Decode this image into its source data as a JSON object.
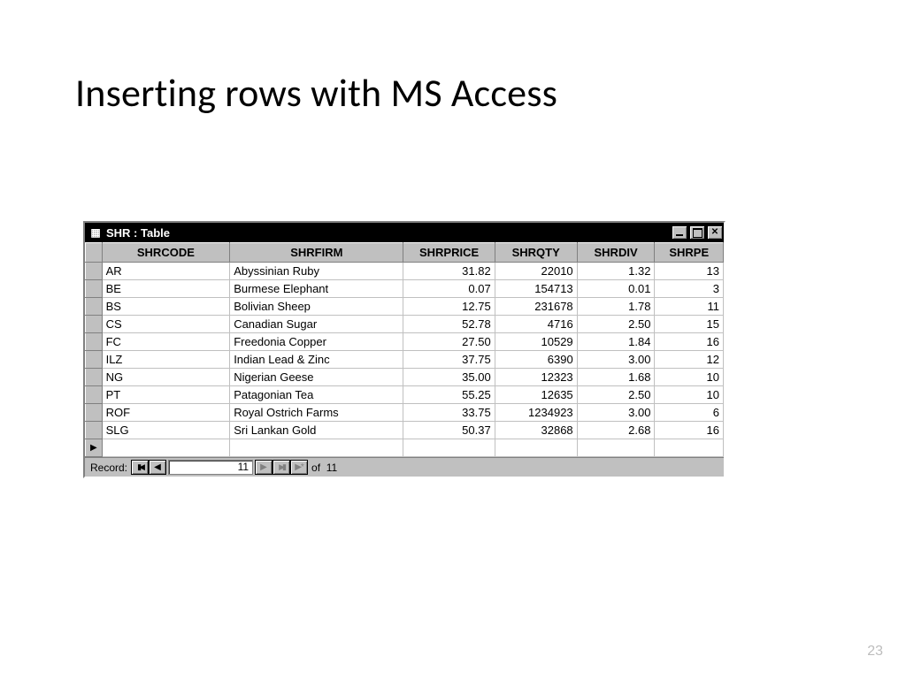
{
  "slide": {
    "title": "Inserting rows with MS Access",
    "page_number": "23"
  },
  "window": {
    "title": "SHR : Table"
  },
  "table": {
    "columns": [
      "SHRCODE",
      "SHRFIRM",
      "SHRPRICE",
      "SHRQTY",
      "SHRDIV",
      "SHRPE"
    ],
    "rows": [
      {
        "code": "AR",
        "firm": "Abyssinian Ruby",
        "price": "31.82",
        "qty": "22010",
        "div": "1.32",
        "pe": "13"
      },
      {
        "code": "BE",
        "firm": "Burmese Elephant",
        "price": "0.07",
        "qty": "154713",
        "div": "0.01",
        "pe": "3"
      },
      {
        "code": "BS",
        "firm": "Bolivian Sheep",
        "price": "12.75",
        "qty": "231678",
        "div": "1.78",
        "pe": "11"
      },
      {
        "code": "CS",
        "firm": "Canadian Sugar",
        "price": "52.78",
        "qty": "4716",
        "div": "2.50",
        "pe": "15"
      },
      {
        "code": "FC",
        "firm": "Freedonia Copper",
        "price": "27.50",
        "qty": "10529",
        "div": "1.84",
        "pe": "16"
      },
      {
        "code": "ILZ",
        "firm": "Indian Lead & Zinc",
        "price": "37.75",
        "qty": "6390",
        "div": "3.00",
        "pe": "12"
      },
      {
        "code": "NG",
        "firm": "Nigerian Geese",
        "price": "35.00",
        "qty": "12323",
        "div": "1.68",
        "pe": "10"
      },
      {
        "code": "PT",
        "firm": "Patagonian Tea",
        "price": "55.25",
        "qty": "12635",
        "div": "2.50",
        "pe": "10"
      },
      {
        "code": "ROF",
        "firm": "Royal Ostrich Farms",
        "price": "33.75",
        "qty": "1234923",
        "div": "3.00",
        "pe": "6"
      },
      {
        "code": "SLG",
        "firm": "Sri Lankan Gold",
        "price": "50.37",
        "qty": "32868",
        "div": "2.68",
        "pe": "16"
      }
    ]
  },
  "nav": {
    "label": "Record:",
    "current": "11",
    "of_label": "of",
    "total": "11"
  }
}
